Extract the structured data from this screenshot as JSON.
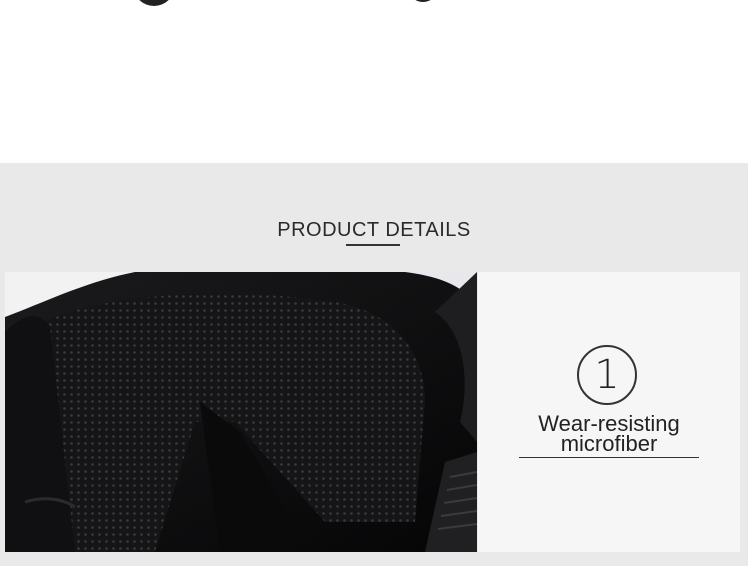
{
  "details": {
    "heading": "PRODUCT DETAILS"
  },
  "feature": {
    "number": "1",
    "title_line1": "Wear-resisting",
    "title_line2": "microfiber"
  },
  "colors": {
    "section_background": "#e9e9e9",
    "panel_background": "#f6f6f6",
    "photo_background": "#0c0c0d",
    "text": "#222222"
  }
}
